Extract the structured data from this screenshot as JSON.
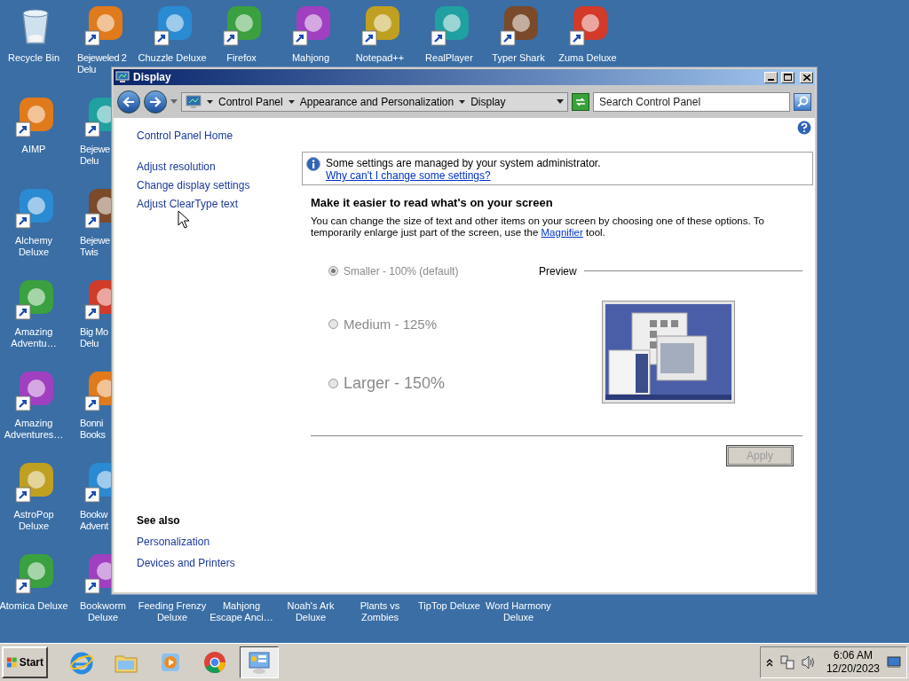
{
  "desktop": {
    "top_row": [
      {
        "label": "Recycle Bin",
        "kind": "bin"
      },
      {
        "lines": [
          "Bejeweled 2",
          "Delu"
        ],
        "kind": "shortcut"
      },
      {
        "label": "Chuzzle Deluxe",
        "kind": "shortcut"
      },
      {
        "label": "Firefox",
        "kind": "shortcut"
      },
      {
        "label": "Mahjong",
        "kind": "shortcut"
      },
      {
        "label": "Notepad++",
        "kind": "shortcut"
      },
      {
        "label": "RealPlayer",
        "kind": "shortcut"
      },
      {
        "label": "Typer Shark",
        "kind": "shortcut"
      },
      {
        "label": "Zuma Deluxe",
        "kind": "shortcut"
      }
    ],
    "column_1": [
      {
        "label": "AIMP",
        "kind": "shortcut"
      },
      {
        "label": "Alchemy Deluxe",
        "kind": "shortcut"
      },
      {
        "label": "Amazing Adventu…",
        "kind": "shortcut"
      },
      {
        "label": "Amazing Adventures…",
        "kind": "shortcut"
      },
      {
        "label": "AstroPop Deluxe",
        "kind": "shortcut"
      }
    ],
    "column_2": [
      {
        "lines": [
          "Bejewe",
          "Delu"
        ],
        "kind": "shortcut"
      },
      {
        "lines": [
          "Bejewe",
          "Twis"
        ],
        "kind": "shortcut"
      },
      {
        "lines": [
          "Big Mo",
          "Delu"
        ],
        "kind": "shortcut"
      },
      {
        "lines": [
          "Bonni",
          "Books"
        ],
        "kind": "shortcut"
      },
      {
        "lines": [
          "Bookw",
          "Advent"
        ],
        "kind": "shortcut"
      }
    ],
    "bottom_row": [
      {
        "label": "Atomica Deluxe",
        "kind": "shortcut"
      },
      {
        "label": "Bookworm Deluxe",
        "kind": "shortcut"
      },
      {
        "label": "Feeding Frenzy Deluxe"
      },
      {
        "label": "Mahjong Escape Anci…"
      },
      {
        "label": "Noah's Ark Deluxe"
      },
      {
        "label": "Plants vs Zombies"
      },
      {
        "label": "TipTop Deluxe"
      },
      {
        "label": "Word Harmony Deluxe"
      }
    ]
  },
  "window": {
    "title": "Display",
    "breadcrumb": [
      "Control Panel",
      "Appearance and Personalization",
      "Display"
    ],
    "search": {
      "placeholder": "Search Control Panel"
    },
    "sidebar": {
      "home": "Control Panel Home",
      "links": [
        "Adjust resolution",
        "Change display settings",
        "Adjust ClearType text"
      ],
      "see_also": {
        "title": "See also",
        "links": [
          "Personalization",
          "Devices and Printers"
        ]
      }
    },
    "info": {
      "text": "Some settings are managed by your system administrator.",
      "link": "Why can't I change some settings?"
    },
    "heading": "Make it easier to read what's on your screen",
    "description": {
      "before": "You can change the size of text and other items on your screen by choosing one of these options. To temporarily enlarge just part of the screen, use the",
      "link": "Magnifier",
      "after": "tool."
    },
    "options": [
      {
        "label": "Smaller - 100% (default)",
        "selected": true,
        "disabled": true
      },
      {
        "label": "Medium - 125%",
        "selected": false,
        "disabled": true
      },
      {
        "label": "Larger - 150%",
        "selected": false,
        "disabled": true
      }
    ],
    "preview_label": "Preview",
    "apply": {
      "label": "Apply",
      "disabled": true
    }
  },
  "taskbar": {
    "start": "Start",
    "apps": [
      {
        "kind": "ie",
        "selected": false
      },
      {
        "kind": "folder",
        "selected": false
      },
      {
        "kind": "media",
        "selected": false
      },
      {
        "kind": "chrome",
        "selected": false
      },
      {
        "kind": "control-panel",
        "selected": true
      }
    ],
    "time": "6:06 AM",
    "date": "12/20/2023"
  }
}
